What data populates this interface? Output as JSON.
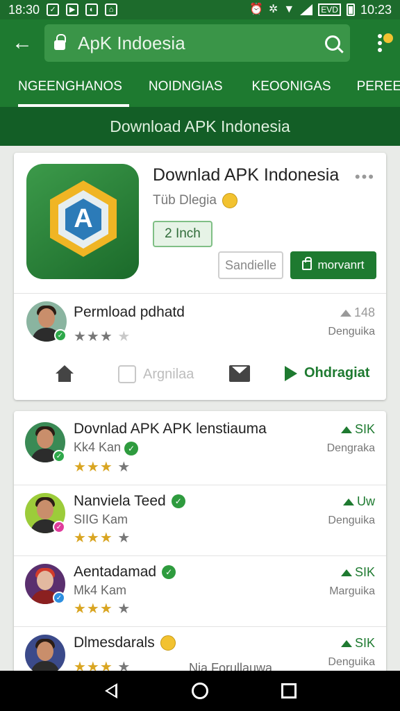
{
  "status_bar": {
    "time_left": "18:30",
    "time_right": "10:23",
    "battery_text": "EVD"
  },
  "app_bar": {
    "search_value": "ApK Indoesia"
  },
  "tabs": [
    {
      "label": "NGEENGHANOS",
      "active": true
    },
    {
      "label": "NOIDNGIAS",
      "active": false
    },
    {
      "label": "KEOONIGAS",
      "active": false
    },
    {
      "label": "PEREEN",
      "active": false
    }
  ],
  "banner": {
    "text": "Download APK Indonesia"
  },
  "app_card": {
    "title": "Downlad APK Indonesia",
    "subtitle": "Tüb Dlegia",
    "size_chip": "2 Inch",
    "secondary_button": "Sandielle",
    "primary_button": "morvanrt",
    "review": {
      "name": "Permload pdhatd",
      "rating": 3,
      "count": "148",
      "label": "Denguika"
    },
    "actions": {
      "like_label": "Argnilaa",
      "share_label": "Ohdragiat"
    }
  },
  "list": [
    {
      "name": "Dovnlad APK APK lenstiauma",
      "sub": "Kk4 Kan",
      "count": "SIK",
      "label": "Dengraka",
      "rating": 3,
      "badge": "green"
    },
    {
      "name": "Nanviela Teed",
      "sub": "SIIG Kam",
      "count": "Uw",
      "label": "Denguika",
      "rating": 3,
      "badge": "pink"
    },
    {
      "name": "Aentadamad",
      "sub": "Mk4 Kam",
      "count": "SIK",
      "label": "Marguika",
      "rating": 3,
      "badge": "blue"
    },
    {
      "name": "Dlmesdarals",
      "sub": "Nia Forullauwa",
      "count": "SIK",
      "label": "Denguika",
      "rating": 3,
      "badge": "blue"
    }
  ],
  "colors": {
    "primary": "#1e7a30",
    "primary_dark": "#135e26",
    "star": "#d9a521"
  },
  "icons": [
    "back-arrow-icon",
    "lock-icon",
    "search-icon",
    "more-vert-icon",
    "home-icon",
    "thumb-up-icon",
    "mail-icon",
    "share-icon",
    "nav-back-icon",
    "nav-home-icon",
    "nav-recents-icon"
  ]
}
